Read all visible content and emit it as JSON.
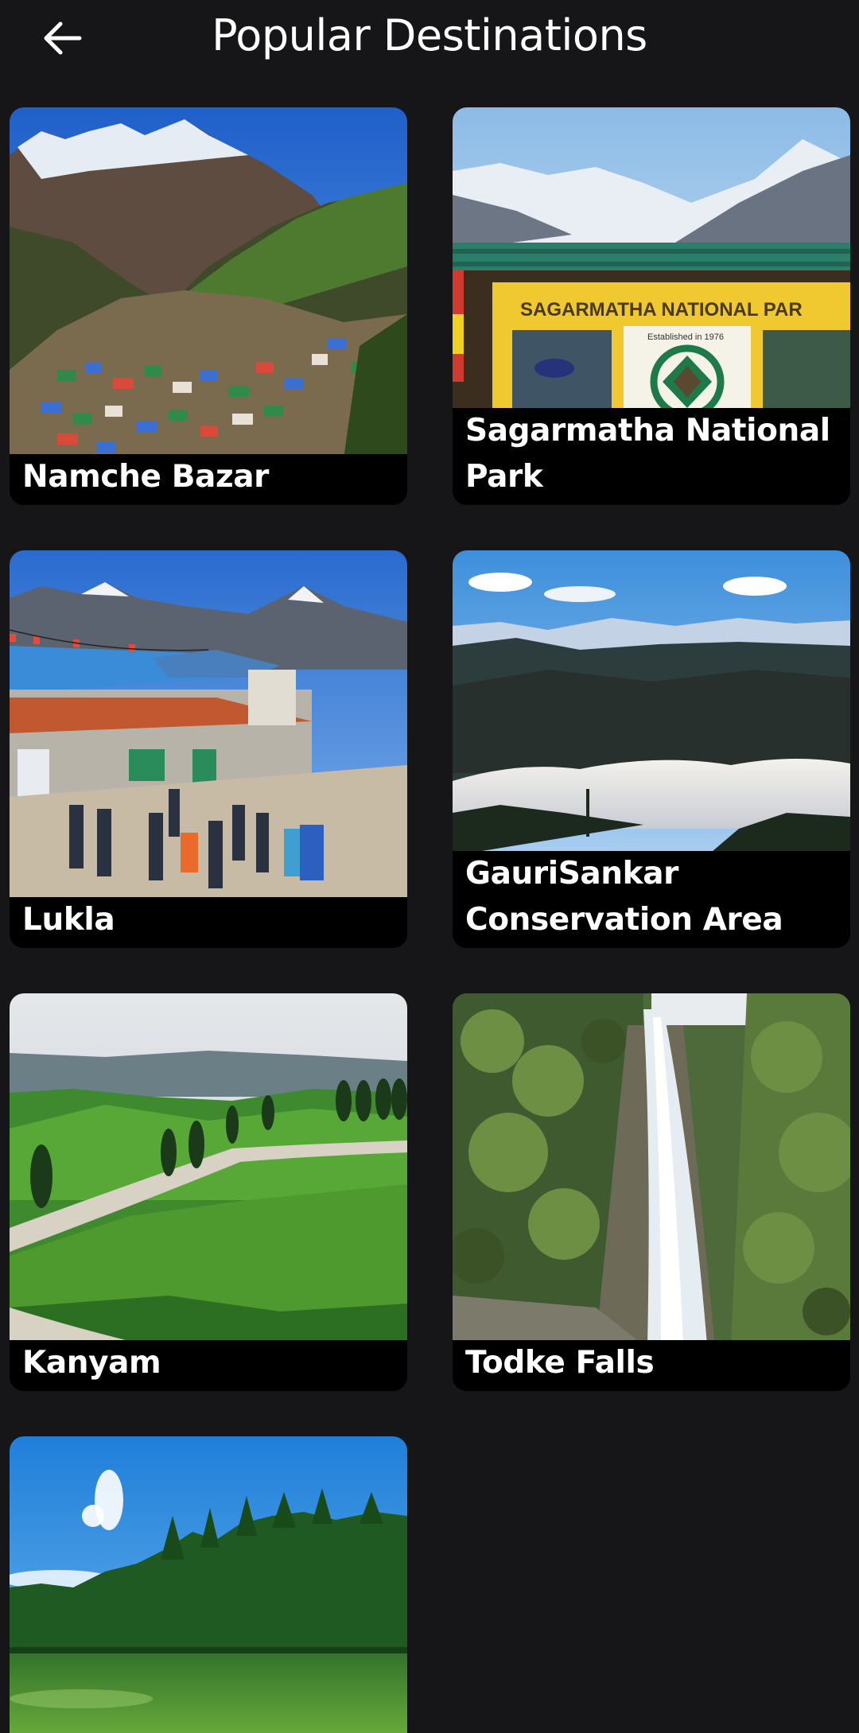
{
  "header": {
    "title": "Popular Destinations",
    "back_icon": "arrow-left-icon"
  },
  "destinations": [
    {
      "name": "Namche Bazar"
    },
    {
      "name": "Sagarmatha National Park",
      "sign_text": "SAGARMATHA NATIONAL PAR",
      "sign_subtext": "Established in 1976"
    },
    {
      "name": "Lukla"
    },
    {
      "name": "GauriSankar Conservation Area"
    },
    {
      "name": "Kanyam"
    },
    {
      "name": "Todke Falls"
    },
    {
      "name": ""
    }
  ],
  "colors": {
    "background": "#161618",
    "caption_background": "#000000",
    "text": "#ffffff"
  }
}
